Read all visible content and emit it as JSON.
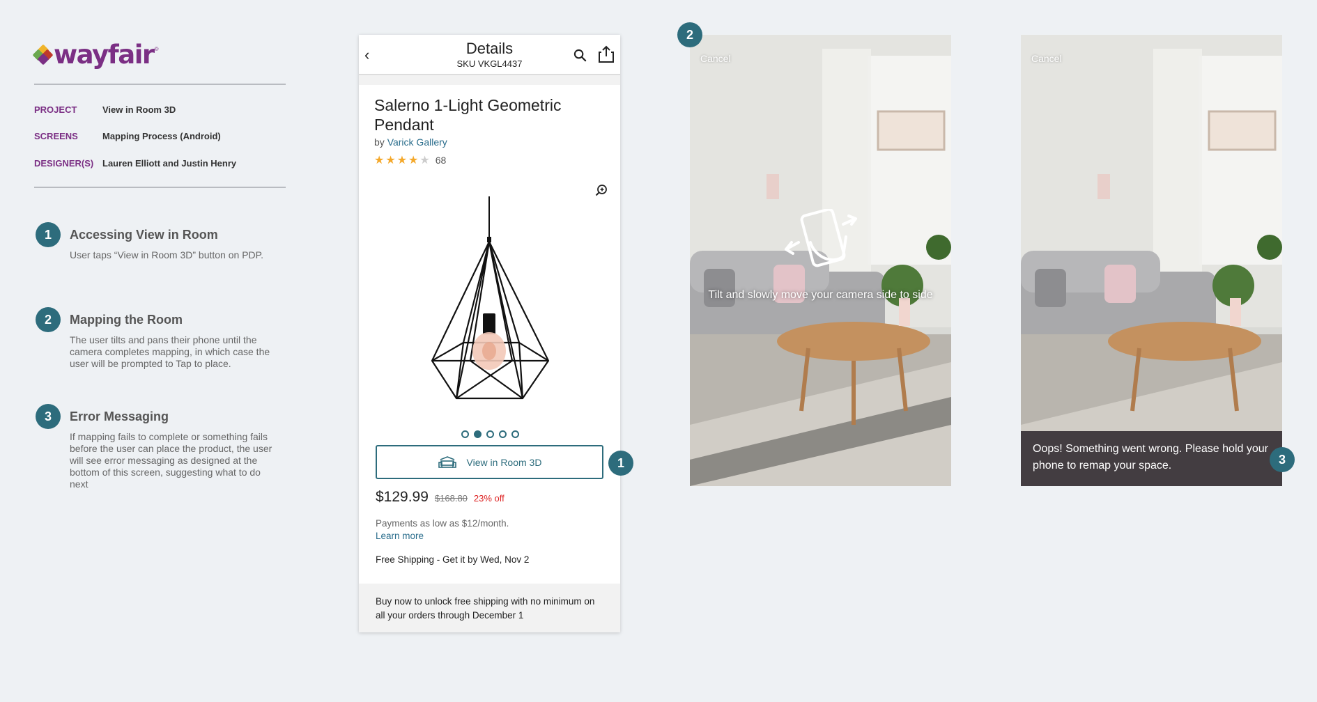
{
  "brand": {
    "name": "wayfair",
    "colors": [
      "#6aa84f",
      "#f0b429",
      "#c0392b",
      "#7b2f84"
    ]
  },
  "meta": [
    {
      "key": "PROJECT",
      "value": "View in Room 3D"
    },
    {
      "key": "SCREENS",
      "value": "Mapping Process (Android)"
    },
    {
      "key": "DESIGNER(S)",
      "value": "Lauren Elliott and Justin Henry"
    }
  ],
  "steps": [
    {
      "num": "1",
      "title": "Accessing View in Room",
      "desc": "User taps “View in Room 3D” button on PDP."
    },
    {
      "num": "2",
      "title": "Mapping the Room",
      "desc": "The user tilts and pans their phone until the camera completes mapping, in which case the user will be prompted to Tap to place."
    },
    {
      "num": "3",
      "title": "Error Messaging",
      "desc": "If mapping fails to complete or something fails before the user can place the product, the user will see error messaging as designed at the bottom of this screen, suggesting what to do next"
    }
  ],
  "pdp": {
    "header_title": "Details",
    "sku": "SKU VKGL4437",
    "product_name": "Salerno 1-Light Geometric Pendant",
    "by_prefix": "by",
    "brand": "Varick Gallery",
    "rating": 4,
    "rating_count": "68",
    "image_index": 2,
    "image_count": 5,
    "view_in_room_label": "View in Room 3D",
    "price": "$129.99",
    "was_price": "$168.80",
    "discount": "23% off",
    "payments": "Payments as low as $12/month.",
    "learn_more": "Learn more",
    "shipping": "Free Shipping - Get it by Wed, Nov 2",
    "promo": "Buy now to unlock free shipping with no minimum on all your orders through December 1"
  },
  "mapping_screen": {
    "cancel": "Cancel",
    "instruction": "Tilt and slowly move your camera side to side"
  },
  "error_screen": {
    "cancel": "Cancel",
    "message": "Oops! Something went wrong. Please hold your phone to remap your space."
  },
  "badges": {
    "pdp": "1",
    "mapping": "2",
    "error": "3"
  },
  "accent_color": "#2d6c7c"
}
